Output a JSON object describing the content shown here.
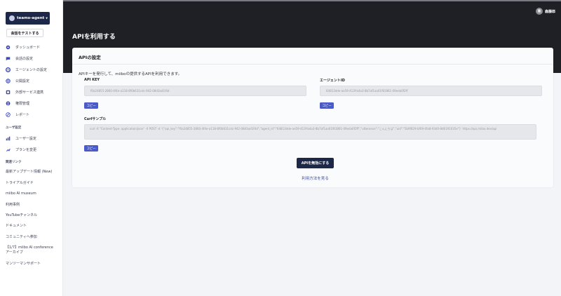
{
  "sidebar": {
    "agent_name": "teams-agent",
    "test_button": "会話をテストする",
    "nav": [
      {
        "label": "ダッシュボード",
        "icon": "dashboard-icon"
      },
      {
        "label": "会話の設定",
        "icon": "chat-icon"
      },
      {
        "label": "エージェントの設定",
        "icon": "agent-gear-icon"
      },
      {
        "label": "公開設定",
        "icon": "globe-icon"
      },
      {
        "label": "外部サービス連携",
        "icon": "integration-icon"
      },
      {
        "label": "権限管理",
        "icon": "permission-icon"
      },
      {
        "label": "レポート",
        "icon": "report-icon"
      }
    ],
    "user_section_label": "ユーザ設定",
    "user_nav": [
      {
        "label": "ユーザー設定",
        "icon": "user-settings-icon"
      },
      {
        "label": "プランを変更",
        "icon": "plan-icon"
      }
    ],
    "links_label": "関連リンク",
    "links": [
      "最新アップデート情報 (New)",
      "トライアルガイド",
      "miibo AI museum",
      "利用事例",
      "YouTubeチャンネル",
      "ドキュメント",
      "コミュニティへ参加",
      "【1/7】miibo AI conference",
      "アーカイブ",
      "マンツーマンサポート"
    ]
  },
  "header": {
    "user_avatar_text": "龍",
    "user_name": "森藤郎"
  },
  "page": {
    "title": "APIを利用する"
  },
  "card": {
    "title": "APIの設定",
    "description": "APIキーを発行して、miiboの提供するAPIを利用できます。",
    "api_key_label": "API KEY",
    "api_key_value": "f0a24855-2860-4f4e-a118-8f0b631cdc-942-08d3ad1f4d",
    "agent_id_label": "エージェントID",
    "agent_id_value": "64813dde-ae59-413f-b4a3-8b7af1aa01f81861-09eda0f2ff",
    "copy_label": "コピー",
    "curl_label": "Curlサンプル",
    "curl_value": "curl -X \"Content-Type: application/json\" -X POST -d '{\"api_key\":\"f0a24855-2860-4f4e-a118-8f0b631cdc-942-08d3ad1f4d\",\"agent_id\":\"64813dde-ae59-413f-b4a3-8b7af1aa01f81861-09eda0f2ff\",\"utterance\":\"こんにちは\",\"uid\":\"5b9f829-bf09-4fa8-93d0-8d6191035e\"}' https://api.miibo.dev/api",
    "disable_button": "APIを無効にする",
    "howto_link": "利用方法を見る"
  }
}
